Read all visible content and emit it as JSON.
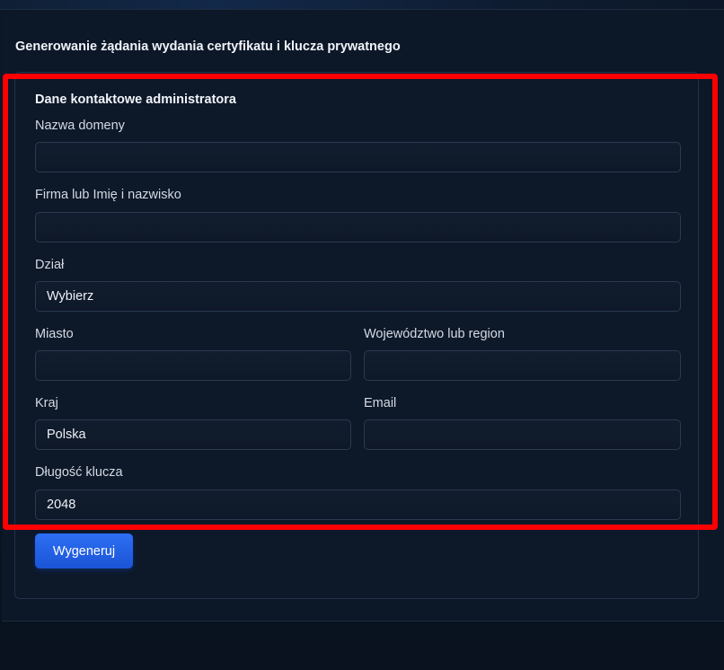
{
  "page": {
    "title": "Generowanie żądania wydania certyfikatu i klucza prywatnego"
  },
  "form": {
    "section_title": "Dane kontaktowe administratora",
    "fields": {
      "domain_name": {
        "label": "Nazwa domeny",
        "value": ""
      },
      "company": {
        "label": "Firma lub Imię i nazwisko",
        "value": ""
      },
      "department": {
        "label": "Dział",
        "value": "Wybierz"
      },
      "city": {
        "label": "Miasto",
        "value": ""
      },
      "region": {
        "label": "Województwo lub region",
        "value": ""
      },
      "country": {
        "label": "Kraj",
        "value": "Polska"
      },
      "email": {
        "label": "Email",
        "value": ""
      },
      "key_length": {
        "label": "Długość klucza",
        "value": "2048"
      }
    },
    "submit_label": "Wygeneruj"
  },
  "colors": {
    "background": "#0b1626",
    "input_border": "#2a3a50",
    "button": "#2563eb",
    "highlight": "#ff0000"
  }
}
